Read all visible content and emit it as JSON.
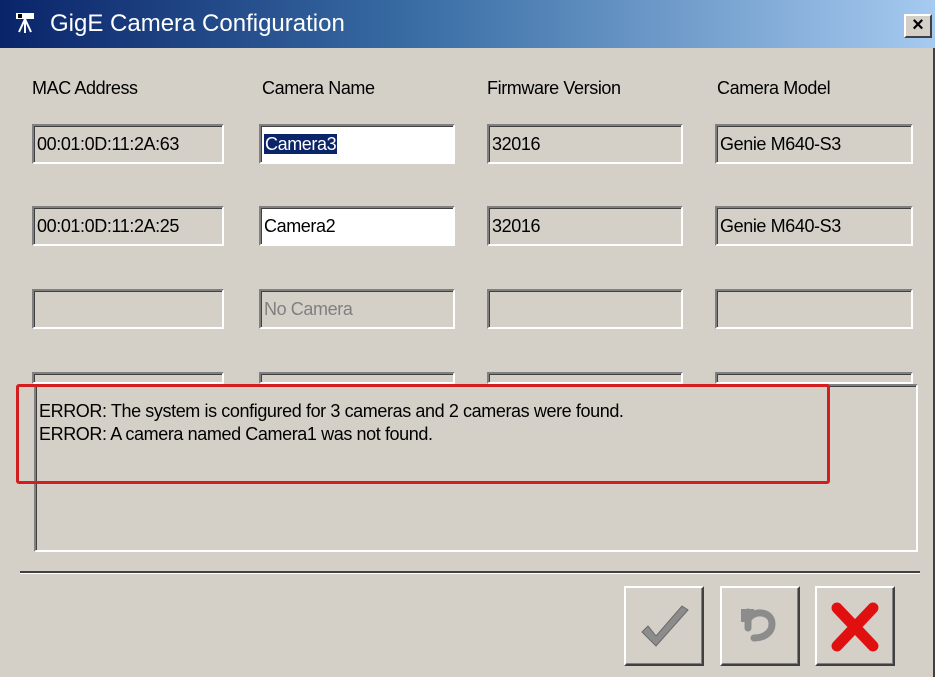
{
  "window": {
    "title": "GigE Camera Configuration",
    "close_label": "×",
    "icon": "camera-tripod-icon"
  },
  "columns": [
    "MAC Address",
    "Camera Name",
    "Firmware Version",
    "Camera Model"
  ],
  "rows": [
    {
      "mac": "00:01:0D:11:2A:63",
      "name": "Camera3",
      "firmware": "32016",
      "model": "Genie M640-S3"
    },
    {
      "mac": "00:01:0D:11:2A:25",
      "name": "Camera2",
      "firmware": "32016",
      "model": "Genie M640-S3"
    },
    {
      "mac": "",
      "name": "No Camera",
      "firmware": "",
      "model": ""
    },
    {
      "mac": "",
      "name": "",
      "firmware": "",
      "model": ""
    }
  ],
  "messages": [
    "ERROR: The system is configured for 3 cameras and 2 cameras were found.",
    "ERROR: A camera named Camera1 was not found."
  ],
  "buttons": {
    "ok_icon": "checkmark-icon",
    "revert_icon": "undo-icon",
    "cancel_icon": "red-x-icon"
  },
  "colors": {
    "title_gradient_start": "#0a246a",
    "dialog_bg": "#d4d0c8",
    "highlight": "#d21e1e",
    "cancel_red": "#e01010"
  }
}
